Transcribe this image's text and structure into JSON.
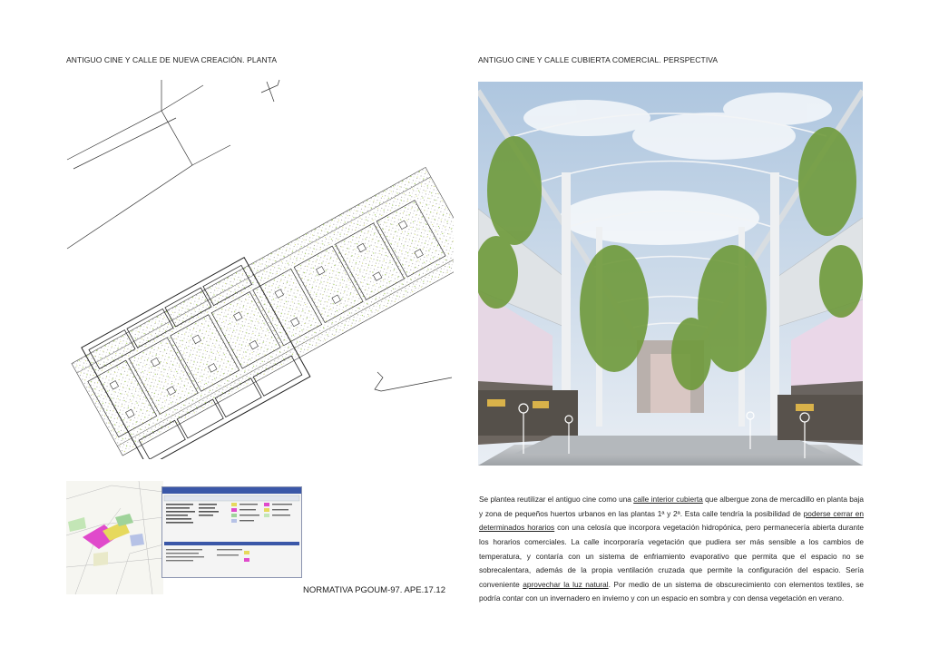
{
  "titles": {
    "plan": "ANTIGUO CINE Y CALLE DE NUEVA CREACIÓN. PLANTA",
    "perspective": "ANTIGUO CINE Y CALLE CUBIERTA COMERCIAL. PERSPECTIVA"
  },
  "normativa_caption": "NORMATIVA PGOUM-97. APE.17.12",
  "description": [
    {
      "t": "Se plantea reutilizar el antiguo cine como una "
    },
    {
      "t": "calle interior cubierta",
      "u": true
    },
    {
      "t": " que albergue zona de mercadillo en planta baja y zona de pequeños huertos urbanos en las plantas 1ª y 2ª. Esta calle tendría la posibilidad de "
    },
    {
      "t": "poderse cerrar en determinados horarios",
      "u": true
    },
    {
      "t": " con una celosía que incorpora vegetación hidropónica, pero permanecería abierta durante los horarios comerciales. La calle incorporaría vegetación que pudiera ser más sensible a los cambios de temperatura, y contaría con un sistema de enfriamiento evaporativo que permita que el espacio no se sobrecalentara, además de la propia ventilación cruzada que permite la configuración del espacio. Sería conveniente "
    },
    {
      "t": "aprovechar la luz natural",
      "u": true
    },
    {
      "t": ". Por medio de un sistema de obscurecimiento con elementos textiles, se podría contar con un invernadero en invierno y con un espacio en sombra y con densa vegetación en verano."
    }
  ]
}
